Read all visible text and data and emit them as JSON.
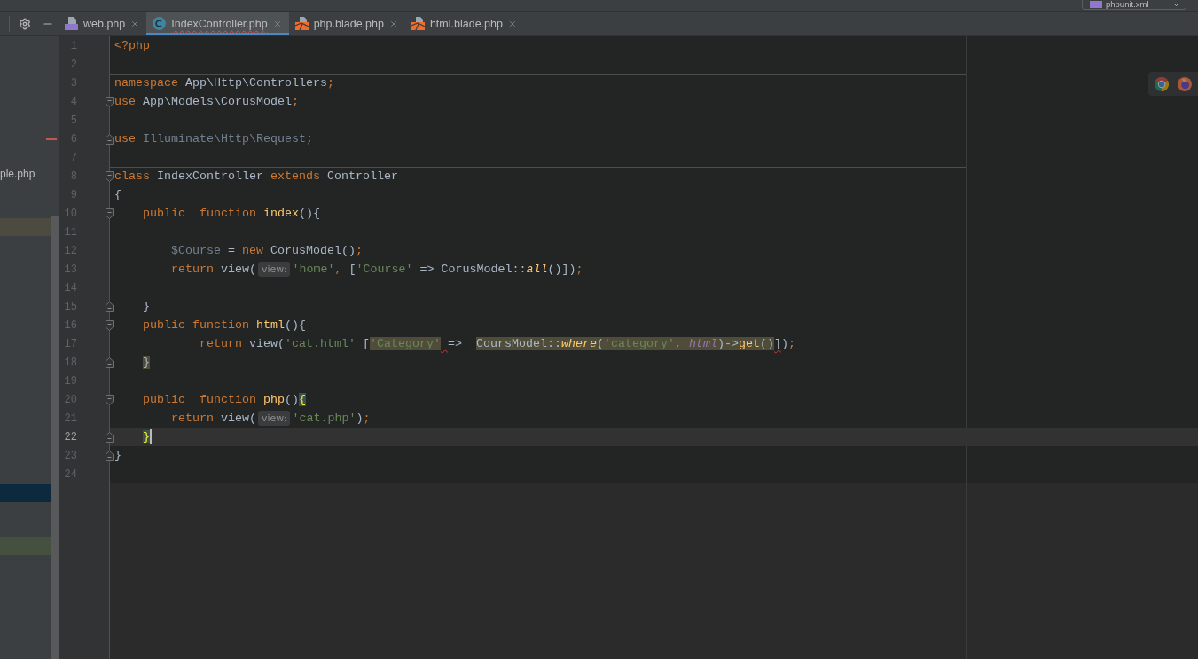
{
  "top_bar": {
    "run_config": {
      "label": "phpunit.xml"
    }
  },
  "project_panel": {
    "rows": [
      {
        "label": "ple.php"
      },
      {
        "color": "#4d4a3f"
      },
      {
        "color": "#0d293e"
      },
      {
        "color": "#45503f"
      }
    ]
  },
  "tabs": [
    {
      "label": "web.php",
      "kind": "php",
      "selected": false,
      "has_errors": false
    },
    {
      "label": "IndexController.php",
      "kind": "class",
      "selected": true,
      "has_errors": true
    },
    {
      "label": "php.blade.php",
      "kind": "blade",
      "selected": false,
      "has_errors": false
    },
    {
      "label": "html.blade.php",
      "kind": "blade",
      "selected": false,
      "has_errors": false
    }
  ],
  "editor": {
    "lines": [
      {
        "number": "1",
        "kind": "plain",
        "current": false,
        "separator": false,
        "tokens": [
          {
            "text": "<?php",
            "kind": "keyword"
          }
        ]
      },
      {
        "number": "2",
        "kind": "plain",
        "current": false,
        "separator": false
      },
      {
        "number": "3",
        "kind": "plain",
        "current": false,
        "separator": true,
        "tokens": [
          {
            "text": "namespace",
            "kind": "keyword"
          },
          {
            "text": " App\\Http\\Controllers",
            "kind": "plain"
          },
          {
            "text": ";",
            "kind": "punct"
          }
        ]
      },
      {
        "number": "4",
        "kind": "fold-start",
        "current": false,
        "separator": false,
        "tokens": [
          {
            "text": "use",
            "kind": "keyword"
          },
          {
            "text": " App\\Models\\CorusModel",
            "kind": "plain"
          },
          {
            "text": ";",
            "kind": "punct"
          }
        ]
      },
      {
        "number": "5",
        "kind": "plain",
        "current": false,
        "separator": false
      },
      {
        "number": "6",
        "kind": "fold-end",
        "current": false,
        "separator": false,
        "tokens": [
          {
            "text": "use",
            "kind": "keyword"
          },
          {
            "text": " Illuminate\\Http\\Request",
            "kind": "unused"
          },
          {
            "text": ";",
            "kind": "punct"
          }
        ]
      },
      {
        "number": "7",
        "kind": "plain",
        "current": false,
        "separator": false
      },
      {
        "number": "8",
        "kind": "fold-start",
        "current": false,
        "separator": true,
        "tokens": [
          {
            "text": "class",
            "kind": "keyword"
          },
          {
            "text": " IndexController ",
            "kind": "plain"
          },
          {
            "text": "extends",
            "kind": "keyword"
          },
          {
            "text": " Controller",
            "kind": "plain"
          }
        ]
      },
      {
        "number": "9",
        "kind": "plain",
        "current": false,
        "separator": false,
        "tokens": [
          {
            "text": "{",
            "kind": "plain"
          }
        ]
      },
      {
        "number": "10",
        "kind": "fold-start",
        "current": false,
        "separator": false,
        "tokens": [
          {
            "text": "    public  function",
            "kind": "keyword"
          },
          {
            "text": " index",
            "kind": "function"
          },
          {
            "text": "(){",
            "kind": "plain"
          }
        ]
      },
      {
        "number": "11",
        "kind": "plain",
        "current": false,
        "separator": false
      },
      {
        "number": "12",
        "kind": "plain",
        "current": false,
        "separator": false,
        "tokens": [
          {
            "text": "        $Course",
            "kind": "unused"
          },
          {
            "text": " = ",
            "kind": "plain"
          },
          {
            "text": "new",
            "kind": "keyword"
          },
          {
            "text": " CorusModel()",
            "kind": "plain"
          },
          {
            "text": ";",
            "kind": "punct"
          }
        ]
      },
      {
        "number": "13",
        "kind": "plain",
        "current": false,
        "separator": false,
        "tokens": [
          {
            "text": "        return",
            "kind": "keyword"
          },
          {
            "text": " view(",
            "kind": "plain"
          },
          {
            "text": "view:",
            "kind": "hint"
          },
          {
            "text": "'home'",
            "kind": "string"
          },
          {
            "text": ",",
            "kind": "punct"
          },
          {
            "text": " [",
            "kind": "plain"
          },
          {
            "text": "'Course'",
            "kind": "string"
          },
          {
            "text": " => CorusModel::",
            "kind": "plain"
          },
          {
            "text": "all",
            "kind": "static"
          },
          {
            "text": "()])",
            "kind": "plain"
          },
          {
            "text": ";",
            "kind": "punct"
          }
        ]
      },
      {
        "number": "14",
        "kind": "plain",
        "current": false,
        "separator": false
      },
      {
        "number": "15",
        "kind": "fold-end",
        "current": false,
        "separator": false,
        "tokens": [
          {
            "text": "    }",
            "kind": "plain"
          }
        ]
      },
      {
        "number": "16",
        "kind": "fold-start",
        "current": false,
        "separator": false,
        "tokens": [
          {
            "text": "    public function",
            "kind": "keyword"
          },
          {
            "text": " html",
            "kind": "function"
          },
          {
            "text": "(){",
            "kind": "plain"
          }
        ]
      },
      {
        "number": "17",
        "kind": "plain",
        "current": false,
        "separator": false,
        "tokens": [
          {
            "text": "            return",
            "kind": "keyword"
          },
          {
            "text": " view(",
            "kind": "plain"
          },
          {
            "text": "'cat.html'",
            "kind": "string"
          },
          {
            "text": " [",
            "kind": "plain"
          },
          {
            "text": "'Category'",
            "kind": "string-usage"
          },
          {
            "text": " =>  ",
            "kind": "plain-error-lead"
          },
          {
            "text": "CoursModel::",
            "kind": "plain-usage"
          },
          {
            "text": "where",
            "kind": "static-usage"
          },
          {
            "text": "(",
            "kind": "plain-usage"
          },
          {
            "text": "'category'",
            "kind": "string-usage"
          },
          {
            "text": ",",
            "kind": "punct-usage"
          },
          {
            "text": " html",
            "kind": "constant-usage"
          },
          {
            "text": ")->",
            "kind": "plain-usage"
          },
          {
            "text": "get",
            "kind": "function-usage"
          },
          {
            "text": "()",
            "kind": "plain-usage"
          },
          {
            "text": "]",
            "kind": "plain-error"
          },
          {
            "text": ")",
            "kind": "plain"
          },
          {
            "text": ";",
            "kind": "punct"
          }
        ]
      },
      {
        "number": "18",
        "kind": "fold-end",
        "current": false,
        "separator": false,
        "tokens": [
          {
            "text": "    }",
            "kind": "plain-usage"
          }
        ]
      },
      {
        "number": "19",
        "kind": "plain",
        "current": false,
        "separator": false
      },
      {
        "number": "20",
        "kind": "fold-start",
        "current": false,
        "separator": false,
        "tokens": [
          {
            "text": "    public  function",
            "kind": "keyword"
          },
          {
            "text": " php",
            "kind": "function"
          },
          {
            "text": "()",
            "kind": "plain"
          },
          {
            "text": "{",
            "kind": "plain-brace"
          }
        ]
      },
      {
        "number": "21",
        "kind": "plain",
        "current": false,
        "separator": false,
        "tokens": [
          {
            "text": "        return",
            "kind": "keyword"
          },
          {
            "text": " view(",
            "kind": "plain"
          },
          {
            "text": "view:",
            "kind": "hint"
          },
          {
            "text": "'cat.php'",
            "kind": "string"
          },
          {
            "text": ")",
            "kind": "plain"
          },
          {
            "text": ";",
            "kind": "punct"
          }
        ]
      },
      {
        "number": "22",
        "kind": "fold-end",
        "current": true,
        "separator": false,
        "tokens": [
          {
            "text": "    }",
            "kind": "plain-brace"
          }
        ]
      },
      {
        "number": "23",
        "kind": "fold-end",
        "current": false,
        "separator": false,
        "tokens": [
          {
            "text": "}",
            "kind": "plain"
          }
        ]
      },
      {
        "number": "24",
        "kind": "plain",
        "current": false,
        "separator": false
      }
    ]
  }
}
